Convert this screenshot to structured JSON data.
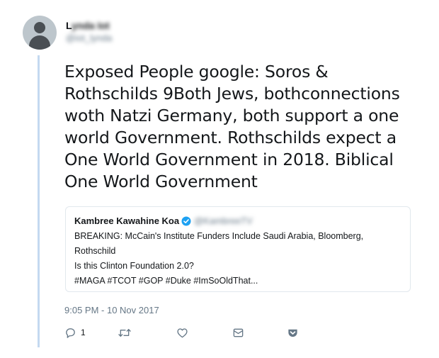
{
  "tweet": {
    "author_name": "Lynda Iot",
    "author_handle": "@iot_lynda",
    "text": "Exposed People google: Soros & Rothschilds 9Both Jews, bothconnections woth Natzi Germany, both support a one world Government. Rothschilds expect a One World Government in 2018. Biblical One World Government",
    "timestamp": "9:05 PM - 10 Nov 2017"
  },
  "quote": {
    "author_name": "Kambree Kawahine Koa",
    "author_handle": "@KambreeTV",
    "lines": [
      "BREAKING: McCain's Institute Funders Include Saudi Arabia, Bloomberg,",
      "Rothschild",
      "Is this Clinton Foundation 2.0?",
      "#MAGA #TCOT #GOP #Duke #ImSoOldThat..."
    ]
  },
  "actions": {
    "reply_count": "1",
    "icons": [
      "reply-icon",
      "retweet-icon",
      "like-icon",
      "message-icon",
      "pocket-icon"
    ]
  },
  "colors": {
    "thread_line": "#c4d9f0",
    "muted": "#657786",
    "verified": "#1da1f2",
    "pocket": "#657786"
  }
}
